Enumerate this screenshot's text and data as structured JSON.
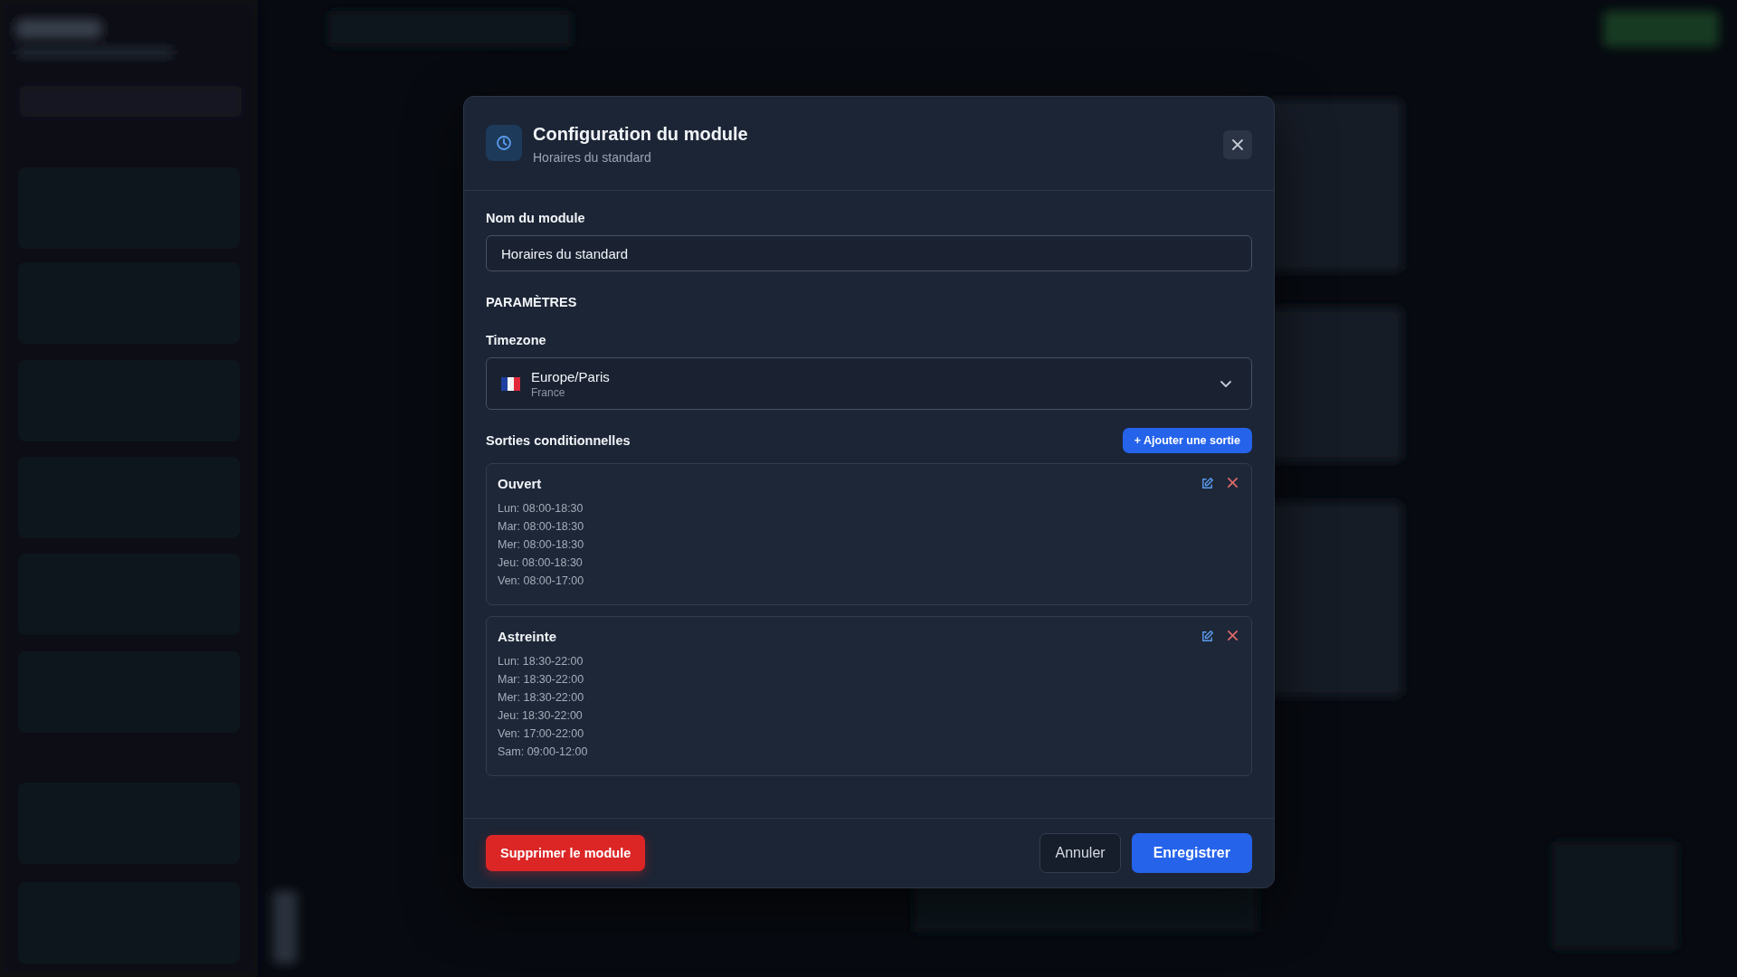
{
  "dialog": {
    "title": "Configuration du module",
    "subtitle": "Horaires du standard",
    "name_field": {
      "label": "Nom du module",
      "value": "Horaires du standard"
    },
    "section_title": "PARAMÈTRES",
    "timezone": {
      "label": "Timezone",
      "value": "Europe/Paris",
      "country": "France"
    },
    "outputs": {
      "label": "Sorties conditionnelles",
      "add_button": "+ Ajouter une sortie",
      "items": [
        {
          "name": "Ouvert",
          "lines": [
            "Lun: 08:00-18:30",
            "Mar: 08:00-18:30",
            "Mer: 08:00-18:30",
            "Jeu: 08:00-18:30",
            "Ven: 08:00-17:00"
          ]
        },
        {
          "name": "Astreinte",
          "lines": [
            "Lun: 18:30-22:00",
            "Mar: 18:30-22:00",
            "Mer: 18:30-22:00",
            "Jeu: 18:30-22:00",
            "Ven: 17:00-22:00",
            "Sam: 09:00-12:00"
          ]
        }
      ]
    },
    "delete_button": "Supprimer le module",
    "cancel_button": "Annuler",
    "save_button": "Enregistrer"
  }
}
